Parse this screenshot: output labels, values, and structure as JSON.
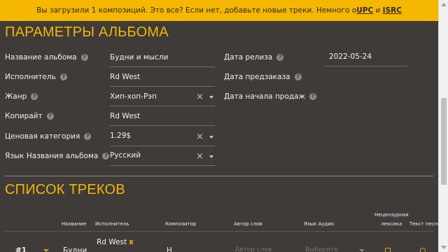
{
  "banner": {
    "text_before": "Вы загрузили 1 композиций. Это все? Если нет, добавьте новые треки. Немного о ",
    "link_upc": "UPC",
    "text_mid": " и ",
    "link_isrc": "ISRC"
  },
  "album": {
    "section_title": "ПАРАМЕТРЫ АЛЬБОМА",
    "fields": {
      "album_name": {
        "label": "Название альбома",
        "value": "Будни и мысли"
      },
      "artist": {
        "label": "Исполнитель",
        "value": "Rd West"
      },
      "genre": {
        "label": "Жанр",
        "value": "Хип-хоп-Рэп"
      },
      "copyright": {
        "label": "Копирайт",
        "value": "Rd West"
      },
      "price": {
        "label": "Ценовая категория",
        "value": "1.29$"
      },
      "language": {
        "label": "Язык Названия альбома",
        "value": "Русский"
      },
      "release_date": {
        "label": "Дата релиза",
        "value": "2022-05-24"
      },
      "preorder_date": {
        "label": "Дата предзаказа",
        "value": ""
      },
      "sales_start_date": {
        "label": "Дата начала продаж",
        "value": ""
      }
    }
  },
  "tracks": {
    "section_title": "СПИСОК ТРЕКОВ",
    "headers": {
      "name": "Название",
      "artist": "Исполнитель",
      "composer": "Композитор",
      "lyricist": "Автор слов",
      "audio_language": "Язык Аудио",
      "explicit_line1": "Нецензурная",
      "explicit_line2": "лексика",
      "lyrics": "Текст песни"
    },
    "row1": {
      "number": "#1",
      "name": "Будни",
      "artist": "Rd West",
      "artist_remove": "x",
      "composer": "Н",
      "lyricist_placeholder": "Автор слов",
      "language_placeholder": "Выберите"
    }
  },
  "help_glyph": "?",
  "clear_glyph": "×",
  "colors": {
    "background": "#3e3b39",
    "accent": "#f5b700",
    "text": "#f2f2f2"
  },
  "icons": {
    "help": "help-circle-icon",
    "clear": "clear-icon",
    "caret": "chevron-down-icon"
  }
}
